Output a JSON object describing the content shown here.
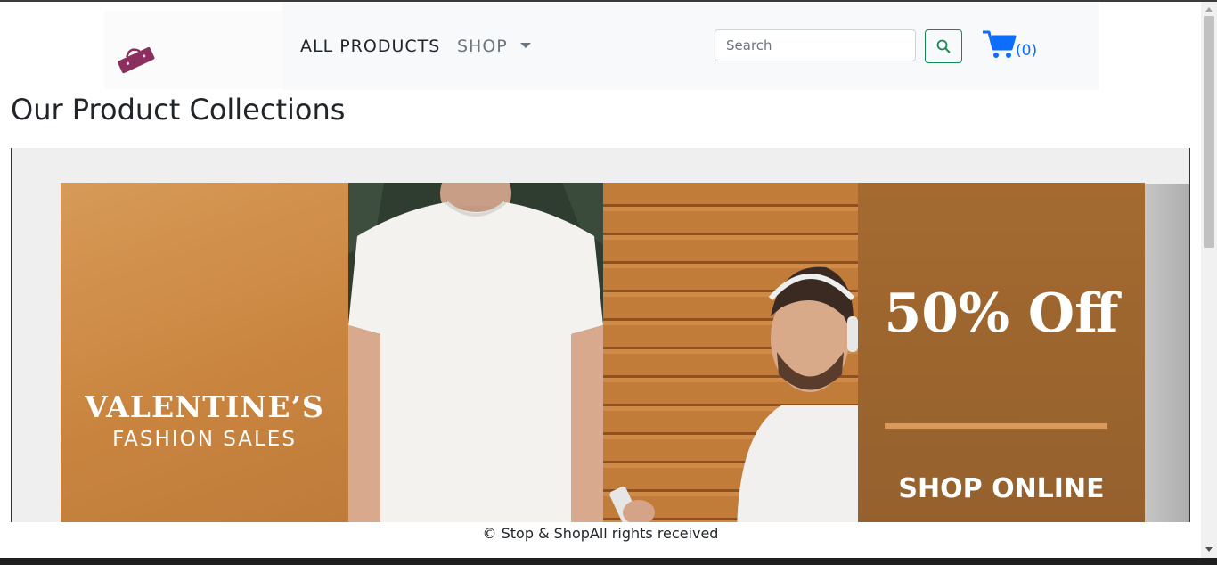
{
  "nav": {
    "logo_alt": "Stop & Shop logo",
    "all_products": "ALL PRODUCTS",
    "shop": "SHOP",
    "search_placeholder": "Search",
    "cart_count": "(0)"
  },
  "page": {
    "title": "Our Product Collections"
  },
  "banner": {
    "headline": "VALENTINE’S",
    "subheadline": "FASHION SALES",
    "discount": "50% Off",
    "cta": "SHOP ONLINE",
    "colors": {
      "primary": "#c9853f",
      "dark": "#a46a30"
    }
  },
  "footer": {
    "text": "© Stop & ShopAll rights received"
  },
  "colors": {
    "navbar_bg": "#f8f9fa",
    "search_button_border": "#198754",
    "cart_icon": "#0d6efd"
  }
}
